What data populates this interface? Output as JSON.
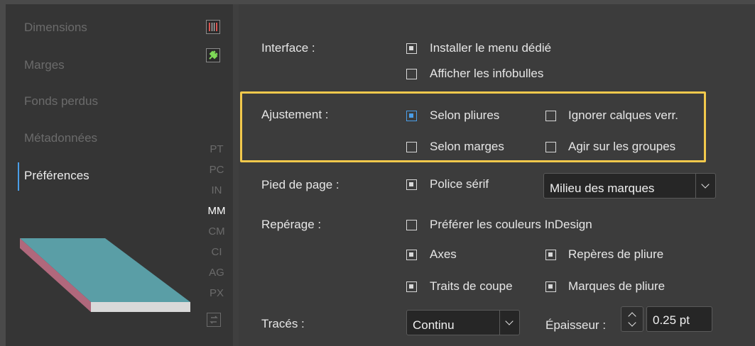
{
  "sidebar": {
    "items": [
      {
        "label": "Dimensions"
      },
      {
        "label": "Marges"
      },
      {
        "label": "Fonds perdus"
      },
      {
        "label": "Métadonnées"
      },
      {
        "label": "Préférences"
      }
    ],
    "active_item": "Préférences",
    "units": [
      "PT",
      "PC",
      "IN",
      "MM",
      "CM",
      "CI",
      "AG",
      "PX"
    ],
    "selected_unit": "MM"
  },
  "prefs": {
    "interface": {
      "label": "Interface :",
      "options": [
        {
          "label": "Installer le menu dédié",
          "checked": true
        },
        {
          "label": "Afficher les infobulles",
          "checked": false
        }
      ]
    },
    "ajustement": {
      "label": "Ajustement :",
      "options": [
        {
          "label": "Selon pliures",
          "checked": true
        },
        {
          "label": "Ignorer calques verr.",
          "checked": false
        },
        {
          "label": "Selon marges",
          "checked": false
        },
        {
          "label": "Agir sur les groupes",
          "checked": false
        }
      ]
    },
    "pied": {
      "label": "Pied de page :",
      "option": {
        "label": "Police sérif",
        "checked": true
      },
      "select_value": "Milieu des marques"
    },
    "reperage": {
      "label": "Repérage :",
      "options": [
        {
          "label": "Préférer les couleurs InDesign",
          "checked": false
        },
        {
          "label": "Axes",
          "checked": true
        },
        {
          "label": "Repères de pliure",
          "checked": true
        },
        {
          "label": "Traits de coupe",
          "checked": true
        },
        {
          "label": "Marques de pliure",
          "checked": true
        }
      ]
    },
    "traces": {
      "label": "Tracés :",
      "select_value": "Continu",
      "epaisseur_label": "Épaisseur :",
      "epaisseur_value": "0.25 pt"
    }
  },
  "colors": {
    "highlight": "#f2c94c",
    "accent": "#4a9ee8",
    "preview_top": "#5a9ea6",
    "preview_side": "#b0687c",
    "preview_front": "#d9d9d9"
  },
  "icons": [
    "ruler-icon",
    "plugin-icon",
    "swap-icon",
    "chevron-down-icon",
    "stepper-icon"
  ]
}
